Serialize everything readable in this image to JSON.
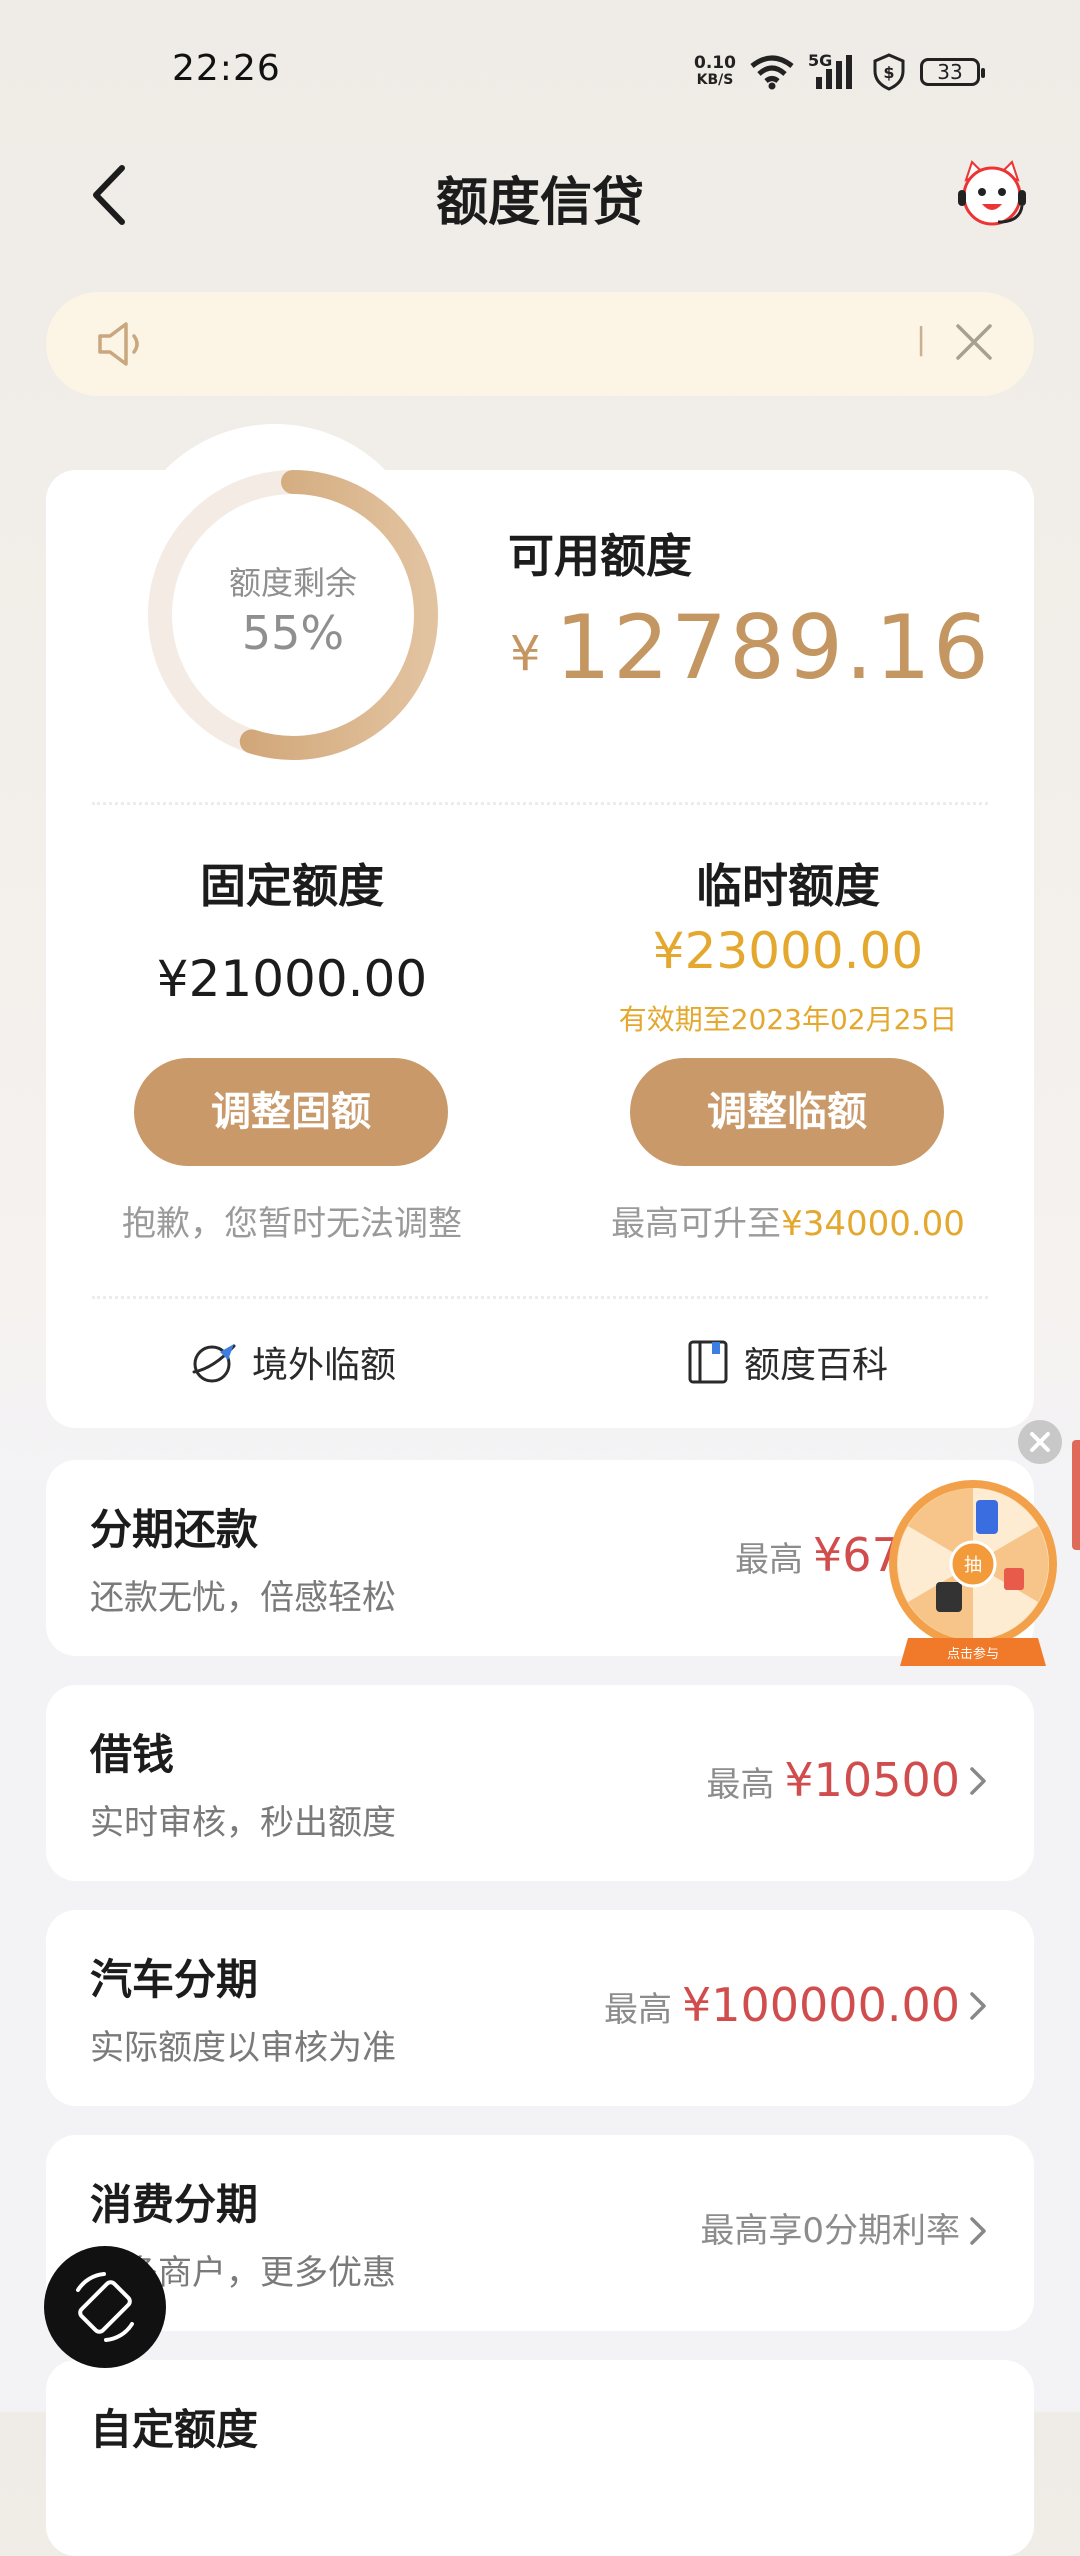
{
  "status": {
    "time": "22:26",
    "net_speed": "0.10",
    "net_unit": "KB/S",
    "signal": "5G",
    "battery": "33"
  },
  "header": {
    "title": "额度信贷"
  },
  "notice": {
    "text": "|"
  },
  "credit": {
    "ring_label": "额度剩余",
    "ring_percent": "55%",
    "remaining_fraction": 0.55,
    "available_label": "可用额度",
    "currency": "¥",
    "available_amount": "12789.16",
    "fixed": {
      "title": "固定额度",
      "amount": "¥21000.00",
      "button": "调整固额",
      "note": "抱歉，您暂时无法调整"
    },
    "temporary": {
      "title": "临时额度",
      "amount": "¥23000.00",
      "valid": "有效期至2023年02月25日",
      "button": "调整临额",
      "note_prefix": "最高可升至",
      "note_amount": "¥34000.00"
    },
    "quick_links": [
      {
        "label": "境外临额"
      },
      {
        "label": "额度百科"
      }
    ]
  },
  "products": [
    {
      "title": "分期还款",
      "subtitle": "还款无忧，倍感轻松",
      "prefix": "最高",
      "amount": "¥670.0"
    },
    {
      "title": "借钱",
      "subtitle": "实时审核，秒出额度",
      "prefix": "最高",
      "amount": "¥10500"
    },
    {
      "title": "汽车分期",
      "subtitle": "实际额度以审核为准",
      "prefix": "最高",
      "amount": "¥100000.00"
    },
    {
      "title": "消费分期",
      "subtitle": "更多商户，更多优惠",
      "prefix": "最高享0分期利率",
      "amount": ""
    },
    {
      "title": "自定额度",
      "subtitle": "",
      "prefix": "",
      "amount": ""
    }
  ],
  "wheel": {
    "center": "抽",
    "caption": "点击参与"
  },
  "colors": {
    "gold": "#c9996a",
    "gold_text": "#e3a82d",
    "red": "#d14d4d"
  }
}
